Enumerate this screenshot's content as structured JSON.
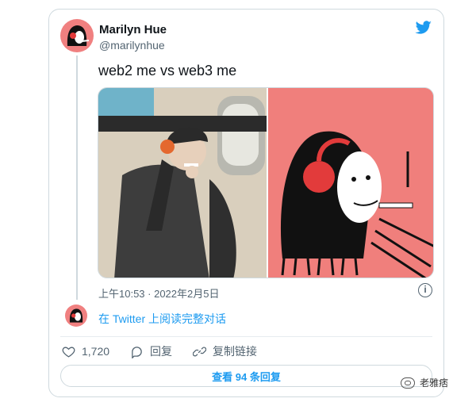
{
  "tweet": {
    "display_name": "Marilyn Hue",
    "handle": "@marilynhue",
    "text": "web2 me vs web3 me",
    "timestamp": "上午10:53 · 2022年2月5日",
    "thread_link": "在 Twitter 上阅读完整对话",
    "actions": {
      "likes": "1,720",
      "reply_label": "回复",
      "copy_label": "复制链接"
    },
    "replies_button": "查看 94 条回复"
  },
  "watermark": {
    "text": "老雅痞"
  },
  "colors": {
    "accent": "#1d9bf0",
    "avatar_bg": "#f08080"
  }
}
